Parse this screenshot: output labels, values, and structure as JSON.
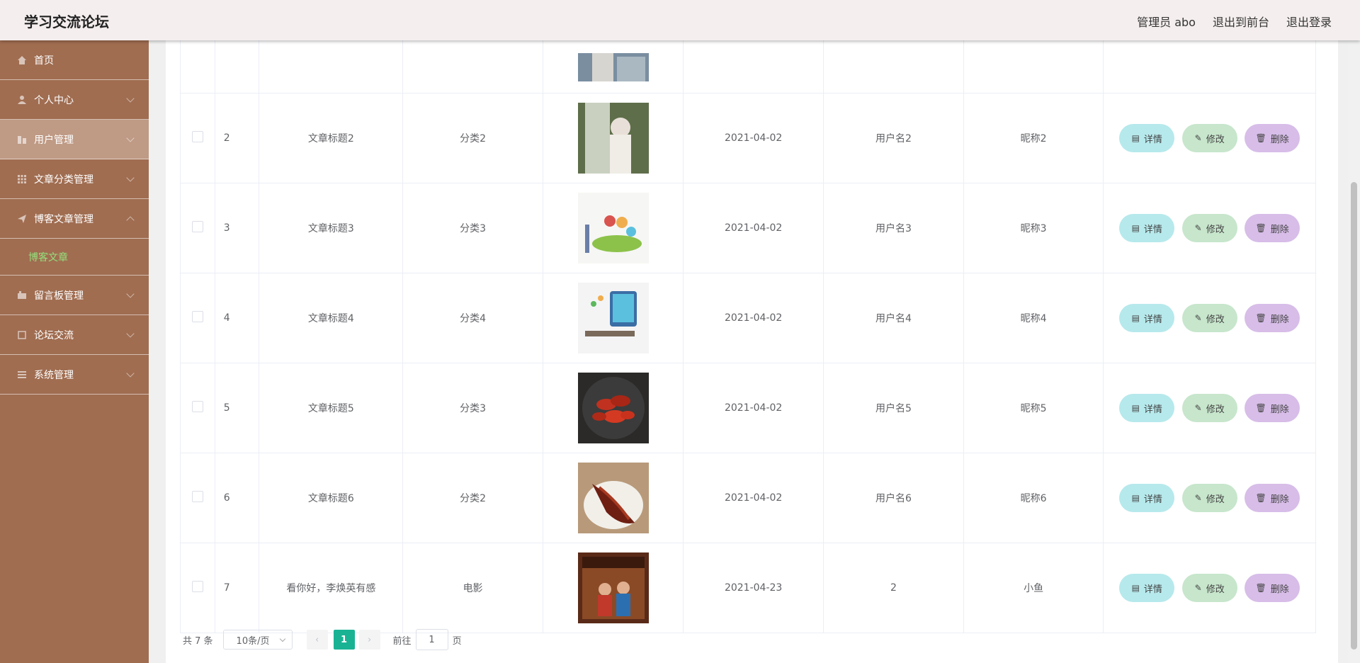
{
  "header": {
    "title": "学习交流论坛",
    "admin": "管理员 abo",
    "front": "退出到前台",
    "logout": "退出登录"
  },
  "sidebar": {
    "items": [
      {
        "label": "首页"
      },
      {
        "label": "个人中心"
      },
      {
        "label": "用户管理"
      },
      {
        "label": "文章分类管理"
      },
      {
        "label": "博客文章管理"
      },
      {
        "label": "留言板管理"
      },
      {
        "label": "论坛交流"
      },
      {
        "label": "系统管理"
      }
    ],
    "sub_item": "博客文章"
  },
  "buttons": {
    "detail": "详情",
    "edit": "修改",
    "delete": "删除"
  },
  "rows": [
    {
      "no": "2",
      "title": "文章标题2",
      "category": "分类2",
      "date": "2021-04-02",
      "user": "用户名2",
      "nick": "昵称2"
    },
    {
      "no": "3",
      "title": "文章标题3",
      "category": "分类3",
      "date": "2021-04-02",
      "user": "用户名3",
      "nick": "昵称3"
    },
    {
      "no": "4",
      "title": "文章标题4",
      "category": "分类4",
      "date": "2021-04-02",
      "user": "用户名4",
      "nick": "昵称4"
    },
    {
      "no": "5",
      "title": "文章标题5",
      "category": "分类3",
      "date": "2021-04-02",
      "user": "用户名5",
      "nick": "昵称5"
    },
    {
      "no": "6",
      "title": "文章标题6",
      "category": "分类2",
      "date": "2021-04-02",
      "user": "用户名6",
      "nick": "昵称6"
    },
    {
      "no": "7",
      "title": "看你好，李焕英有感",
      "category": "电影",
      "date": "2021-04-23",
      "user": "2",
      "nick": "小鱼"
    }
  ],
  "pagination": {
    "total": "共 7 条",
    "page_size": "10条/页",
    "current": "1",
    "goto_label": "前往",
    "goto_value": "1",
    "page_unit": "页"
  }
}
